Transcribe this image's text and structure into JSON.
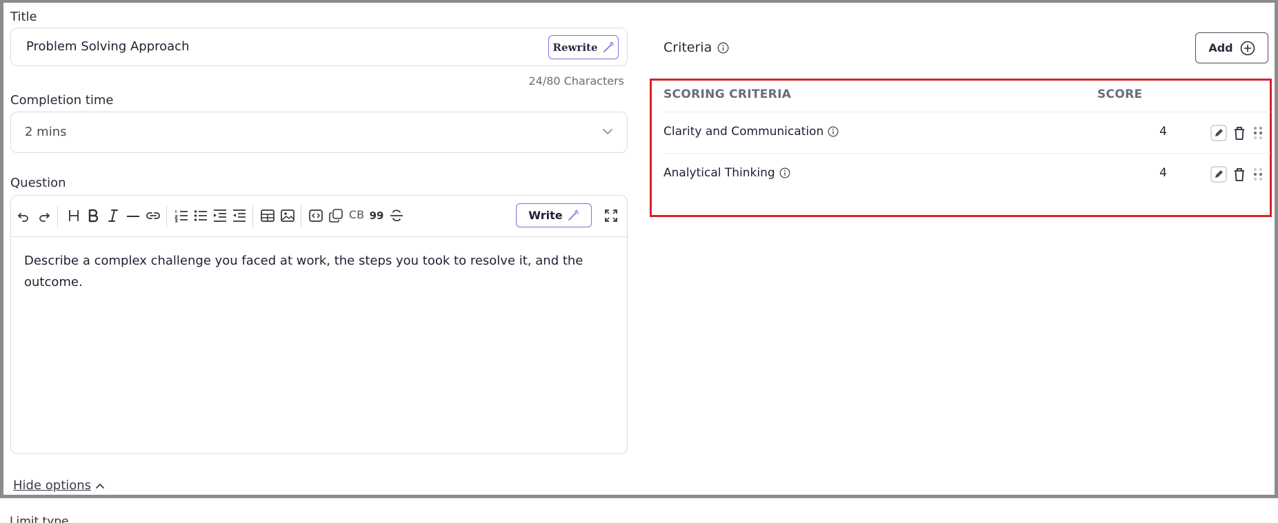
{
  "title_field": {
    "label": "Title",
    "value": "Problem Solving Approach",
    "rewrite_label": "Rewrite",
    "counter": "24/80 Characters"
  },
  "completion": {
    "label": "Completion time",
    "value": "2 mins"
  },
  "question": {
    "label": "Question",
    "write_label": "Write",
    "cb_label": "CB",
    "quote_label": "99",
    "body": "Describe a complex challenge you faced at work, the steps you took to resolve it, and the outcome."
  },
  "hide_options": "Hide options",
  "below_label": "Limit type",
  "criteria": {
    "label": "Criteria",
    "add_label": "Add",
    "col_name": "SCORING CRITERIA",
    "col_score": "SCORE",
    "rows": [
      {
        "name": "Clarity and Communication",
        "score": "4"
      },
      {
        "name": "Analytical Thinking",
        "score": "4"
      }
    ]
  },
  "colors": {
    "accent": "#7b6fe0",
    "highlight_border": "#d9202a",
    "border": "#dadce4"
  }
}
